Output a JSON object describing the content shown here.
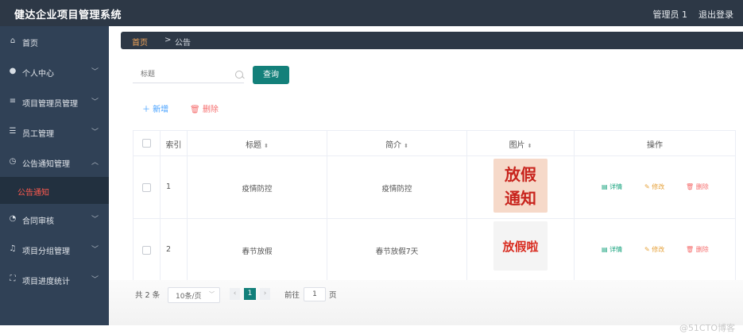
{
  "header": {
    "title": "健达企业项目管理系统",
    "user": "管理员 1",
    "logout": "退出登录"
  },
  "sidebar": {
    "items": [
      {
        "label": "首页",
        "icon": "home-icon",
        "has_chevron": false
      },
      {
        "label": "个人中心",
        "icon": "user-icon",
        "has_chevron": true
      },
      {
        "label": "项目管理员管理",
        "icon": "list-icon",
        "has_chevron": true
      },
      {
        "label": "员工管理",
        "icon": "sliders-icon",
        "has_chevron": true
      },
      {
        "label": "公告通知管理",
        "icon": "clock-icon",
        "has_chevron": true,
        "expanded": true
      },
      {
        "label": "合同审核",
        "icon": "gauge-icon",
        "has_chevron": true
      },
      {
        "label": "项目分组管理",
        "icon": "bell-icon",
        "has_chevron": true
      },
      {
        "label": "项目进度统计",
        "icon": "fullscreen-icon",
        "has_chevron": true
      }
    ],
    "active_submenu": "公告通知"
  },
  "breadcrumb": {
    "home": "首页",
    "separator": ">",
    "current": "公告"
  },
  "search": {
    "placeholder": "标题",
    "button": "查询"
  },
  "actions": {
    "add": "＋ 新增",
    "delete": "🗑 删除"
  },
  "table": {
    "columns": [
      "",
      "索引",
      "标题",
      "简介",
      "图片",
      "操作"
    ],
    "rows": [
      {
        "index": "1",
        "title": "疫情防控",
        "intro": "疫情防控",
        "image_text": [
          "放假",
          "通知"
        ]
      },
      {
        "index": "2",
        "title": "春节放假",
        "intro": "春节放假7天",
        "image_text": [
          "放假啦"
        ]
      }
    ],
    "ops": {
      "view": "详情",
      "edit": "修改",
      "delete": "删除"
    }
  },
  "pagination": {
    "total": "共 2 条",
    "page_size": "10条/页",
    "current": "1",
    "goto_label": "前往",
    "goto_value": "1",
    "goto_suffix": "页"
  },
  "watermark": "@51CTO博客",
  "colors": {
    "header_bg": "#2d3846",
    "sidebar_bg": "#304156",
    "primary": "#13807a",
    "danger": "#f56c6c",
    "active_menu": "#ff5a4f"
  }
}
